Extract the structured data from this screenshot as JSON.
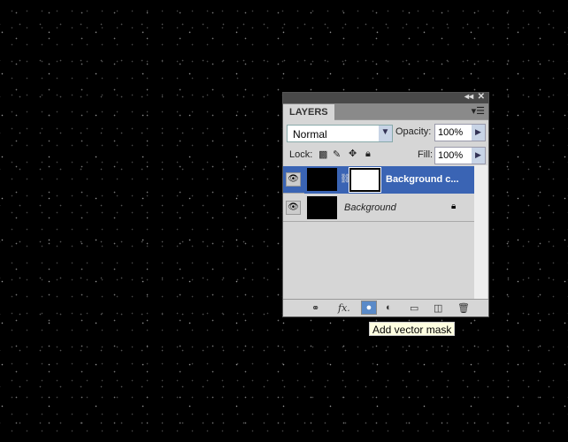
{
  "panel": {
    "tab": "LAYERS",
    "blend_mode": "Normal",
    "opacity_label": "Opacity:",
    "opacity": "100%",
    "lock_label": "Lock:",
    "fill_label": "Fill:",
    "fill": "100%"
  },
  "layers": [
    {
      "name": "Background c...",
      "selected": true,
      "has_mask": true
    },
    {
      "name": "Background",
      "locked": true
    }
  ],
  "tooltip": "Add vector mask",
  "colors": {
    "selected": "#3a64b4",
    "panel": "#d6d6d6"
  }
}
